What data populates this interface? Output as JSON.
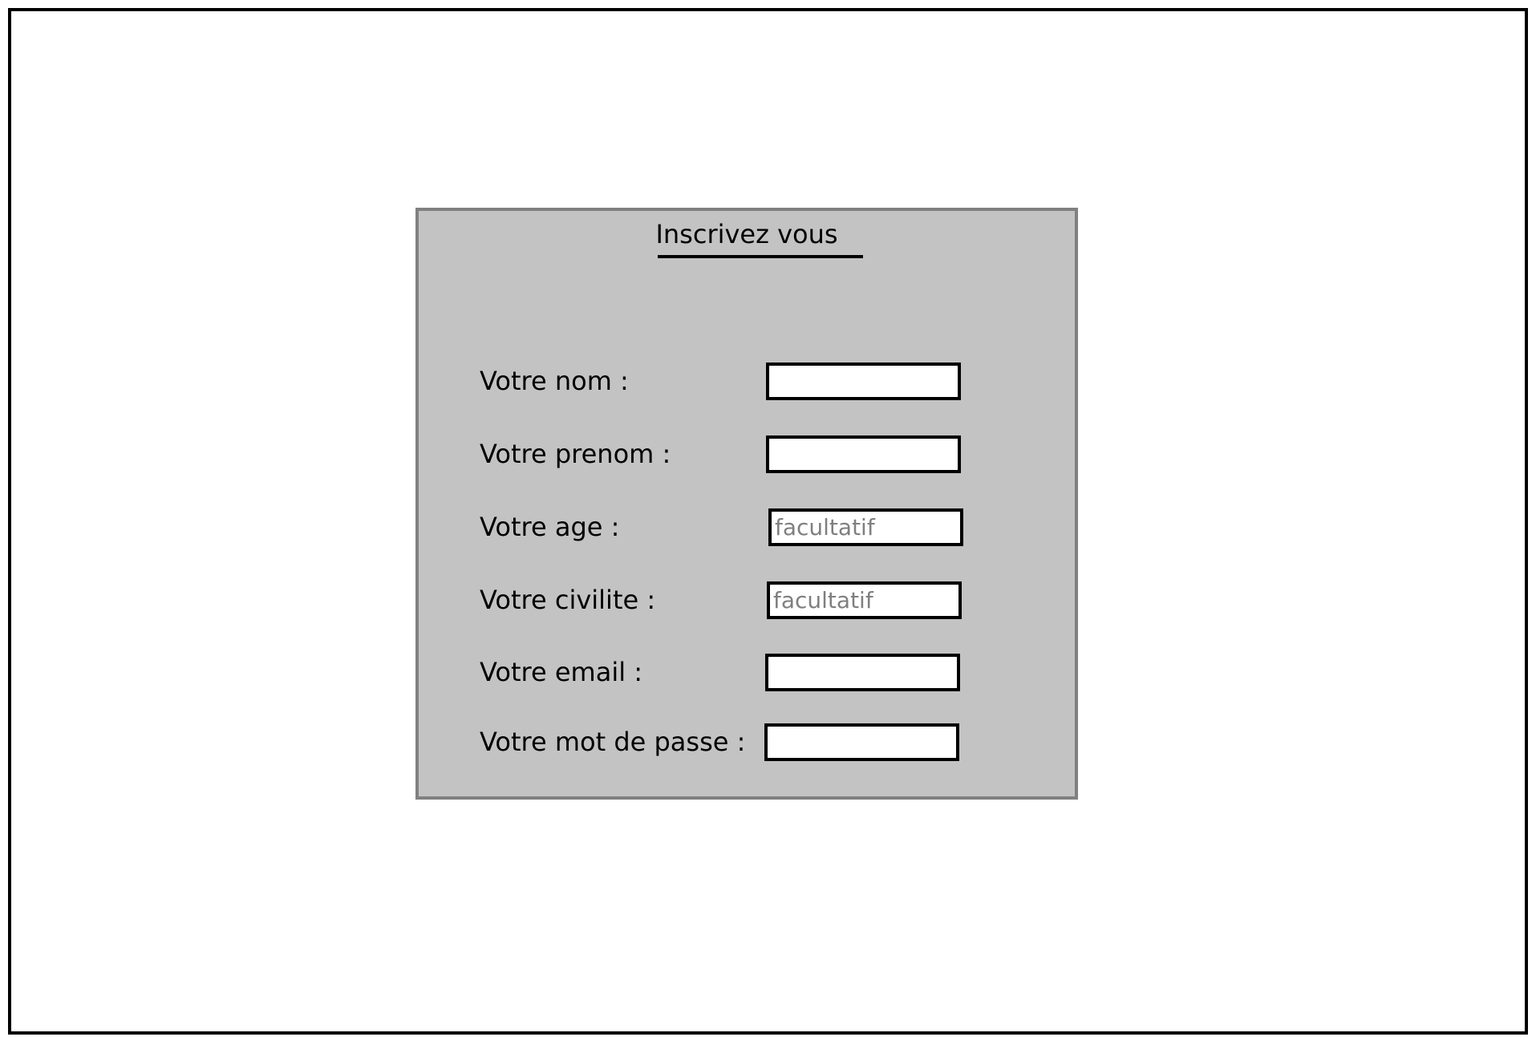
{
  "form": {
    "title": "Inscrivez vous",
    "fields": [
      {
        "label": "Votre nom :",
        "value": "",
        "placeholder": ""
      },
      {
        "label": "Votre prenom :",
        "value": "",
        "placeholder": ""
      },
      {
        "label": "Votre age :",
        "value": "",
        "placeholder": "facultatif"
      },
      {
        "label": "Votre civilite :",
        "value": "",
        "placeholder": "facultatif"
      },
      {
        "label": "Votre email :",
        "value": "",
        "placeholder": ""
      },
      {
        "label": "Votre mot de passe :",
        "value": "",
        "placeholder": ""
      }
    ]
  },
  "colors": {
    "panel_background": "#c3c3c3",
    "panel_border": "#808080",
    "input_background": "#ffffff",
    "input_border": "#000000",
    "placeholder_text": "#7f7f7f",
    "page_background": "#ffffff"
  }
}
